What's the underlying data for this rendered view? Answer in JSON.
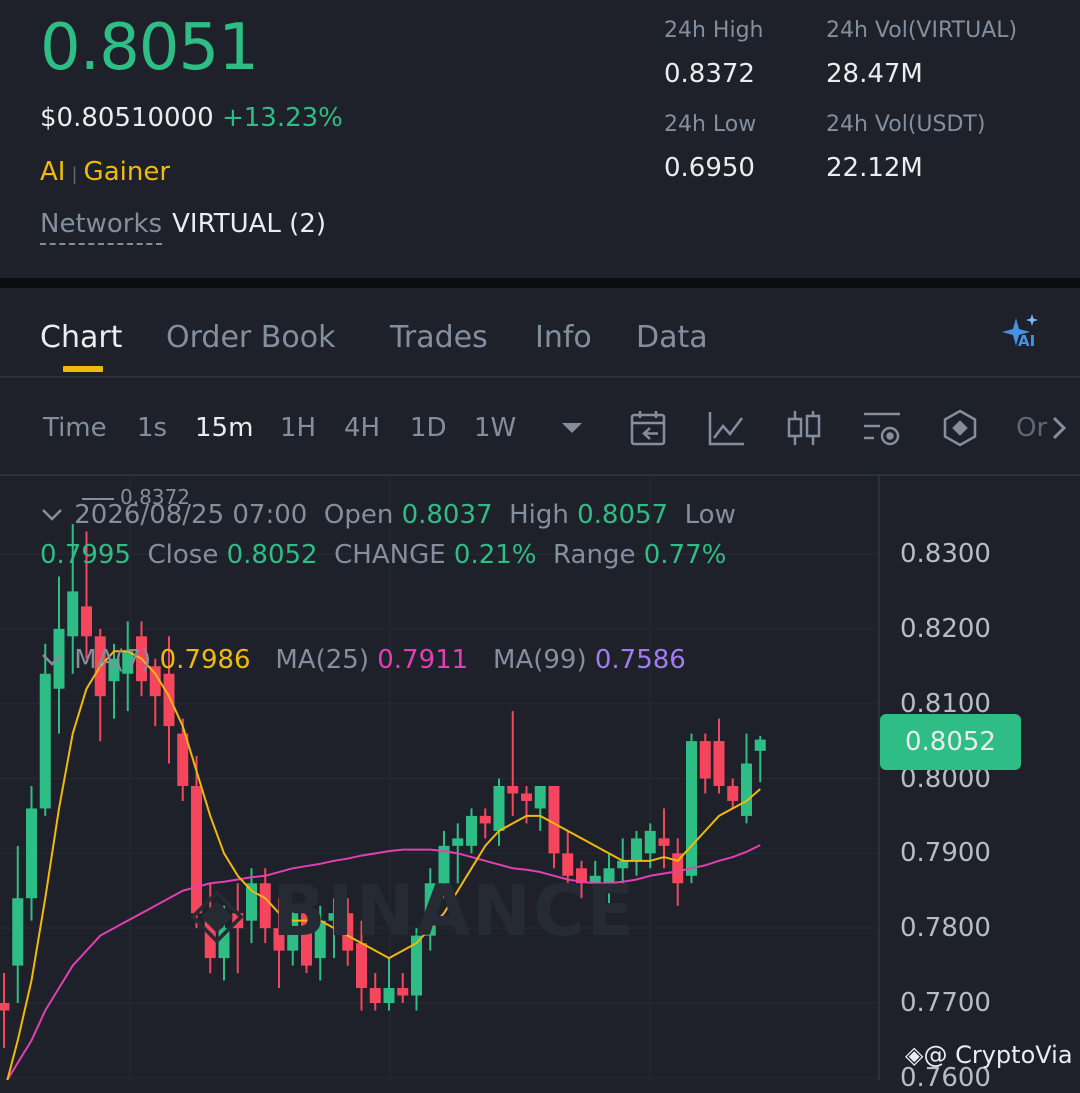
{
  "header": {
    "price": "0.8051",
    "usd_price": "$0.80510000",
    "change_pct": "+13.23%",
    "tags": [
      "AI",
      "Gainer"
    ],
    "networks_label": "Networks",
    "networks_value": "VIRTUAL (2)",
    "stats": {
      "high_label": "24h High",
      "high_value": "0.8372",
      "low_label": "24h Low",
      "low_value": "0.6950",
      "vol_base_label": "24h Vol(VIRTUAL)",
      "vol_base_value": "28.47M",
      "vol_quote_label": "24h Vol(USDT)",
      "vol_quote_value": "22.12M"
    }
  },
  "tabs": [
    {
      "label": "Chart",
      "active": true
    },
    {
      "label": "Order Book",
      "active": false
    },
    {
      "label": "Trades",
      "active": false
    },
    {
      "label": "Info",
      "active": false
    },
    {
      "label": "Data",
      "active": false
    }
  ],
  "ai_badge": "AI",
  "toolbar": {
    "timeframes": [
      {
        "label": "Time",
        "active": false
      },
      {
        "label": "1s",
        "active": false
      },
      {
        "label": "15m",
        "active": true
      },
      {
        "label": "1H",
        "active": false
      },
      {
        "label": "4H",
        "active": false
      },
      {
        "label": "1D",
        "active": false
      },
      {
        "label": "1W",
        "active": false
      }
    ],
    "more_label": "Or",
    "icons": [
      "chevron-down-icon",
      "calendar-back-icon",
      "line-chart-icon",
      "candle-type-icon",
      "indicator-settings-icon",
      "hexagon-icon",
      "chevron-right-icon"
    ]
  },
  "ohlc": {
    "date": "2026/08/25 07:00",
    "open_label": "Open",
    "open": "0.8037",
    "high_label": "High",
    "high": "0.8057",
    "low_label": "Low",
    "low": "0.7995",
    "close_label": "Close",
    "close": "0.8052",
    "change_label": "CHANGE",
    "change": "0.21%",
    "range_label": "Range",
    "range": "0.77%"
  },
  "ma": {
    "ma7_label": "MA(7)",
    "ma7": "0.7986",
    "ma25_label": "MA(25)",
    "ma25": "0.7911",
    "ma99_label": "MA(99)",
    "ma99": "0.7586"
  },
  "colors": {
    "up": "#2ebd85",
    "down": "#f6465d",
    "ma7": "#f0b90b",
    "ma25": "#e040b4",
    "ma99": "#a07cf0",
    "accent": "#f0b90b",
    "background": "#1e2129"
  },
  "chart_data": {
    "type": "candlestick",
    "y_ticks": [
      "0.8300",
      "0.8200",
      "0.8100",
      "0.8000",
      "0.7900",
      "0.7800",
      "0.7700",
      "0.7600"
    ],
    "ylim": [
      0.758,
      0.8345
    ],
    "high_marker": "0.8372",
    "last_price": "0.8052",
    "candles": [
      {
        "o": 0.77,
        "h": 0.774,
        "l": 0.764,
        "c": 0.769
      },
      {
        "o": 0.775,
        "h": 0.791,
        "l": 0.77,
        "c": 0.784
      },
      {
        "o": 0.784,
        "h": 0.799,
        "l": 0.781,
        "c": 0.796
      },
      {
        "o": 0.796,
        "h": 0.818,
        "l": 0.795,
        "c": 0.814
      },
      {
        "o": 0.812,
        "h": 0.827,
        "l": 0.806,
        "c": 0.82
      },
      {
        "o": 0.819,
        "h": 0.834,
        "l": 0.814,
        "c": 0.825
      },
      {
        "o": 0.823,
        "h": 0.833,
        "l": 0.816,
        "c": 0.819
      },
      {
        "o": 0.819,
        "h": 0.82,
        "l": 0.805,
        "c": 0.811
      },
      {
        "o": 0.813,
        "h": 0.818,
        "l": 0.808,
        "c": 0.816
      },
      {
        "o": 0.814,
        "h": 0.821,
        "l": 0.809,
        "c": 0.817
      },
      {
        "o": 0.819,
        "h": 0.821,
        "l": 0.811,
        "c": 0.813
      },
      {
        "o": 0.815,
        "h": 0.816,
        "l": 0.807,
        "c": 0.811
      },
      {
        "o": 0.814,
        "h": 0.819,
        "l": 0.802,
        "c": 0.807
      },
      {
        "o": 0.806,
        "h": 0.808,
        "l": 0.797,
        "c": 0.799
      },
      {
        "o": 0.799,
        "h": 0.803,
        "l": 0.78,
        "c": 0.782
      },
      {
        "o": 0.782,
        "h": 0.786,
        "l": 0.774,
        "c": 0.776
      },
      {
        "o": 0.776,
        "h": 0.783,
        "l": 0.773,
        "c": 0.78
      },
      {
        "o": 0.782,
        "h": 0.786,
        "l": 0.774,
        "c": 0.78
      },
      {
        "o": 0.781,
        "h": 0.788,
        "l": 0.778,
        "c": 0.786
      },
      {
        "o": 0.786,
        "h": 0.788,
        "l": 0.778,
        "c": 0.78
      },
      {
        "o": 0.78,
        "h": 0.784,
        "l": 0.772,
        "c": 0.777
      },
      {
        "o": 0.777,
        "h": 0.783,
        "l": 0.775,
        "c": 0.782
      },
      {
        "o": 0.782,
        "h": 0.784,
        "l": 0.774,
        "c": 0.775
      },
      {
        "o": 0.776,
        "h": 0.783,
        "l": 0.773,
        "c": 0.781
      },
      {
        "o": 0.781,
        "h": 0.784,
        "l": 0.776,
        "c": 0.782
      },
      {
        "o": 0.782,
        "h": 0.784,
        "l": 0.775,
        "c": 0.777
      },
      {
        "o": 0.778,
        "h": 0.781,
        "l": 0.769,
        "c": 0.772
      },
      {
        "o": 0.772,
        "h": 0.774,
        "l": 0.769,
        "c": 0.77
      },
      {
        "o": 0.77,
        "h": 0.776,
        "l": 0.769,
        "c": 0.772
      },
      {
        "o": 0.772,
        "h": 0.774,
        "l": 0.77,
        "c": 0.771
      },
      {
        "o": 0.771,
        "h": 0.78,
        "l": 0.769,
        "c": 0.779
      },
      {
        "o": 0.779,
        "h": 0.788,
        "l": 0.777,
        "c": 0.786
      },
      {
        "o": 0.786,
        "h": 0.793,
        "l": 0.784,
        "c": 0.791
      },
      {
        "o": 0.791,
        "h": 0.794,
        "l": 0.786,
        "c": 0.792
      },
      {
        "o": 0.791,
        "h": 0.796,
        "l": 0.79,
        "c": 0.795
      },
      {
        "o": 0.795,
        "h": 0.796,
        "l": 0.792,
        "c": 0.794
      },
      {
        "o": 0.793,
        "h": 0.8,
        "l": 0.791,
        "c": 0.799
      },
      {
        "o": 0.799,
        "h": 0.809,
        "l": 0.795,
        "c": 0.798
      },
      {
        "o": 0.798,
        "h": 0.799,
        "l": 0.794,
        "c": 0.797
      },
      {
        "o": 0.796,
        "h": 0.799,
        "l": 0.793,
        "c": 0.799
      },
      {
        "o": 0.799,
        "h": 0.799,
        "l": 0.788,
        "c": 0.79
      },
      {
        "o": 0.79,
        "h": 0.793,
        "l": 0.786,
        "c": 0.787
      },
      {
        "o": 0.788,
        "h": 0.789,
        "l": 0.784,
        "c": 0.786
      },
      {
        "o": 0.786,
        "h": 0.789,
        "l": 0.784,
        "c": 0.787
      },
      {
        "o": 0.785,
        "h": 0.79,
        "l": 0.783,
        "c": 0.788
      },
      {
        "o": 0.788,
        "h": 0.792,
        "l": 0.786,
        "c": 0.789
      },
      {
        "o": 0.789,
        "h": 0.793,
        "l": 0.787,
        "c": 0.792
      },
      {
        "o": 0.79,
        "h": 0.794,
        "l": 0.788,
        "c": 0.793
      },
      {
        "o": 0.792,
        "h": 0.796,
        "l": 0.788,
        "c": 0.791
      },
      {
        "o": 0.79,
        "h": 0.792,
        "l": 0.783,
        "c": 0.786
      },
      {
        "o": 0.787,
        "h": 0.806,
        "l": 0.786,
        "c": 0.805
      },
      {
        "o": 0.805,
        "h": 0.806,
        "l": 0.798,
        "c": 0.8
      },
      {
        "o": 0.805,
        "h": 0.808,
        "l": 0.798,
        "c": 0.799
      },
      {
        "o": 0.799,
        "h": 0.8,
        "l": 0.796,
        "c": 0.797
      },
      {
        "o": 0.795,
        "h": 0.806,
        "l": 0.794,
        "c": 0.802
      },
      {
        "o": 0.8037,
        "h": 0.8057,
        "l": 0.7995,
        "c": 0.8052
      }
    ],
    "ma7": [
      0.758,
      0.765,
      0.773,
      0.784,
      0.796,
      0.806,
      0.812,
      0.815,
      0.817,
      0.817,
      0.816,
      0.814,
      0.811,
      0.807,
      0.801,
      0.795,
      0.79,
      0.787,
      0.785,
      0.784,
      0.782,
      0.781,
      0.781,
      0.781,
      0.78,
      0.779,
      0.778,
      0.777,
      0.776,
      0.777,
      0.778,
      0.78,
      0.782,
      0.785,
      0.788,
      0.791,
      0.793,
      0.794,
      0.795,
      0.795,
      0.794,
      0.793,
      0.792,
      0.791,
      0.79,
      0.789,
      0.789,
      0.789,
      0.7895,
      0.789,
      0.791,
      0.793,
      0.795,
      0.796,
      0.797,
      0.7986
    ],
    "ma25": [
      0.759,
      0.762,
      0.765,
      0.769,
      0.772,
      0.775,
      0.777,
      0.779,
      0.78,
      0.781,
      0.782,
      0.783,
      0.784,
      0.785,
      0.7855,
      0.786,
      0.7862,
      0.7865,
      0.7868,
      0.787,
      0.7875,
      0.788,
      0.7883,
      0.7886,
      0.789,
      0.7893,
      0.7897,
      0.79,
      0.7903,
      0.7905,
      0.7905,
      0.7905,
      0.7903,
      0.79,
      0.7895,
      0.789,
      0.7885,
      0.788,
      0.7878,
      0.7875,
      0.787,
      0.7865,
      0.7862,
      0.786,
      0.786,
      0.7862,
      0.7865,
      0.787,
      0.7873,
      0.7876,
      0.788,
      0.7884,
      0.789,
      0.7895,
      0.7902,
      0.7911
    ]
  },
  "watermark": "BINANCE",
  "credit": "@ CryptoVia"
}
